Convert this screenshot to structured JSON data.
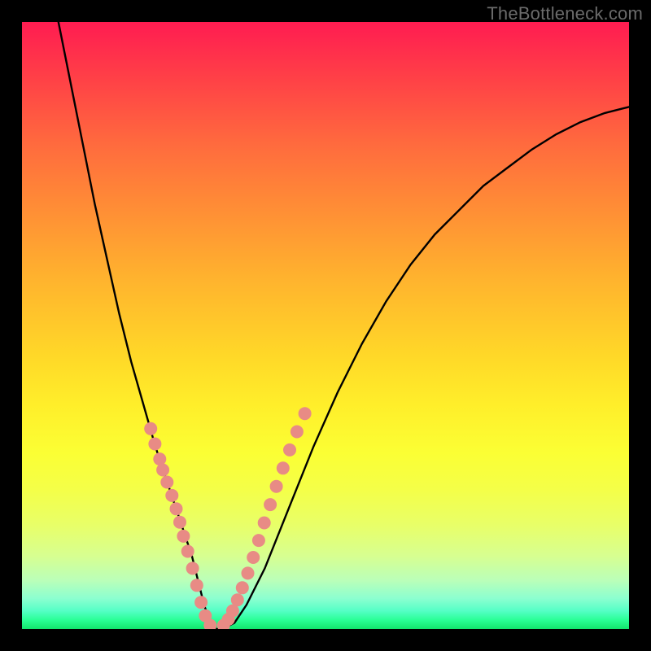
{
  "attribution": "TheBottleneck.com",
  "colors": {
    "background": "#000000",
    "bead": "#e88b85",
    "curve": "#000000"
  },
  "chart_data": {
    "type": "line",
    "title": "",
    "xlabel": "",
    "ylabel": "",
    "xlim": [
      0,
      100
    ],
    "ylim": [
      0,
      100
    ],
    "grid": false,
    "note": "Axes are unlabeled in the image; values are estimated relative to plot-area extent (0–100 each axis).",
    "series": [
      {
        "name": "curve",
        "x": [
          6,
          8,
          10,
          12,
          14,
          16,
          18,
          20,
          22,
          24,
          26,
          28,
          29,
          30,
          31,
          32,
          33,
          35,
          37,
          40,
          44,
          48,
          52,
          56,
          60,
          64,
          68,
          72,
          76,
          80,
          84,
          88,
          92,
          96,
          100
        ],
        "y": [
          100,
          90,
          80,
          70,
          61,
          52,
          44,
          37,
          30,
          24,
          18,
          12,
          8,
          4,
          1,
          0,
          0,
          1,
          4,
          10,
          20,
          30,
          39,
          47,
          54,
          60,
          65,
          69,
          73,
          76,
          79,
          81.5,
          83.5,
          85,
          86
        ]
      },
      {
        "name": "beads-left",
        "x": [
          21.2,
          21.9,
          22.7,
          23.2,
          23.9,
          24.7,
          25.4,
          26.0,
          26.6,
          27.3,
          28.1,
          28.8,
          29.5,
          30.2,
          31.0
        ],
        "y": [
          33.0,
          30.5,
          28.0,
          26.2,
          24.2,
          22.0,
          19.8,
          17.6,
          15.3,
          12.8,
          10.0,
          7.2,
          4.4,
          2.2,
          0.6
        ]
      },
      {
        "name": "beads-right",
        "x": [
          33.2,
          34.0,
          34.7,
          35.5,
          36.3,
          37.2,
          38.1,
          39.0,
          39.9,
          40.9,
          41.9,
          43.0,
          44.1,
          45.3,
          46.6
        ],
        "y": [
          0.6,
          1.6,
          3.0,
          4.8,
          6.8,
          9.2,
          11.8,
          14.6,
          17.5,
          20.5,
          23.5,
          26.5,
          29.5,
          32.5,
          35.5
        ]
      }
    ]
  }
}
